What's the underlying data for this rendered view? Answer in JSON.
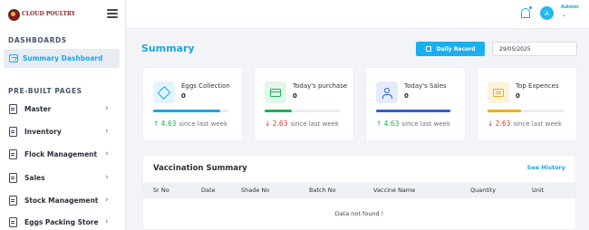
{
  "brand": {
    "name": "CLOUD POULTRY",
    "tagline": ""
  },
  "sidebar": {
    "dashboards_title": "DASHBOARDS",
    "summary_label": "Summary Dashboard",
    "prebuilt_title": "PRE-BUILT PAGES",
    "items": [
      {
        "label": "Master"
      },
      {
        "label": "Inventory"
      },
      {
        "label": "Flock Management"
      },
      {
        "label": "Sales"
      },
      {
        "label": "Stock Management"
      },
      {
        "label": "Eggs Packing Store"
      }
    ]
  },
  "topbar": {
    "user_name": "Admin",
    "avatar_initial": "A"
  },
  "main": {
    "title": "Summary",
    "daily_record_label": "Daily Record",
    "date_value": "29/05/2025"
  },
  "cards": [
    {
      "title": "Eggs Collection",
      "value": "0",
      "change": "4.63",
      "direction": "up",
      "since": "since last week",
      "progress": 0.88,
      "color": "#1aa7e8",
      "icon": "egg-box-icon"
    },
    {
      "title": "Today's purchase",
      "value": "0",
      "change": "2.63",
      "direction": "down",
      "since": "since last week",
      "progress": 0.36,
      "color": "#1fae5b",
      "icon": "credit-card-icon"
    },
    {
      "title": "Today's Sales",
      "value": "0",
      "change": "4.63",
      "direction": "up",
      "since": "since last week",
      "progress": 0.98,
      "color": "#2f5fd6",
      "icon": "users-icon"
    },
    {
      "title": "Top Expences",
      "value": "0",
      "change": "2.63",
      "direction": "down",
      "since": "since last week",
      "progress": 0.44,
      "color": "#f0ad18",
      "icon": "expense-icon"
    }
  ],
  "vaccination": {
    "title": "Vaccination Summary",
    "see_history": "See History",
    "columns": [
      "Sr No",
      "Date",
      "Shade No",
      "Batch No",
      "Vaccine Name",
      "Quantity",
      "Unit"
    ],
    "empty_message": "Data not found !"
  },
  "colors": {
    "accent": "#1aa7e8",
    "up": "#1fae5b",
    "down": "#e0342b"
  }
}
